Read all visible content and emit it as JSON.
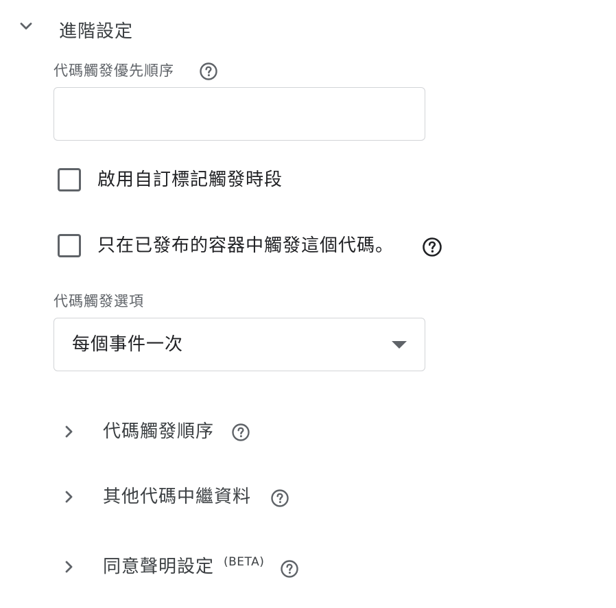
{
  "section": {
    "title": "進階設定",
    "expanded": true,
    "icon": "chevron-down-icon"
  },
  "priority": {
    "label": "代碼觸發優先順序",
    "value": "",
    "help_icon": "help-circle-icon"
  },
  "checkboxes": [
    {
      "label": "啟用自訂標記觸發時段",
      "checked": false
    },
    {
      "label": "只在已發布的容器中觸發這個代碼。",
      "checked": false,
      "help_icon": "help-circle-icon"
    }
  ],
  "firing_options": {
    "label": "代碼觸發選項",
    "selected": "每個事件一次",
    "icon": "dropdown-arrow-icon"
  },
  "subsections": [
    {
      "title": "代碼觸發順序",
      "expanded": false,
      "icon": "chevron-right-icon"
    },
    {
      "title": "其他代碼中繼資料",
      "expanded": false,
      "icon": "chevron-right-icon"
    },
    {
      "title": "同意聲明設定",
      "badge": "(BETA)",
      "expanded": false,
      "icon": "chevron-right-icon"
    }
  ],
  "colors": {
    "text_primary": "#202124",
    "text_secondary": "#5f6368",
    "border": "#d2d4d7",
    "icon": "#5f6368"
  }
}
